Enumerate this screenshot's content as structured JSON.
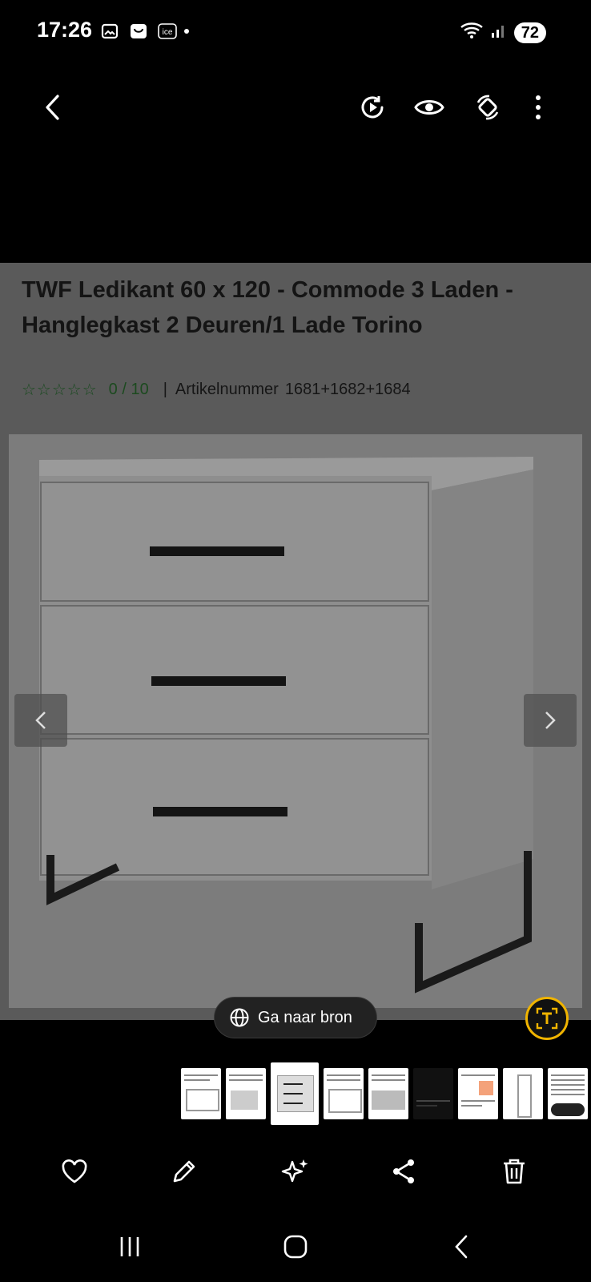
{
  "status_bar": {
    "time": "17:26",
    "left_icons": [
      "photo-frame-icon",
      "shopping-bag-icon",
      "ice-app-icon"
    ],
    "ice_label": "ice",
    "battery": "72",
    "right_icons": [
      "wifi-icon",
      "signal-icon"
    ]
  },
  "top_bar": {
    "back_icon": "chevron-left-icon",
    "actions": [
      "remaster-icon",
      "eye-icon",
      "rotate-icon",
      "more-vert-icon"
    ]
  },
  "document": {
    "title": "TWF Ledikant 60 x 120 - Commode 3 Laden - Hanglegkast 2 Deuren/1 Lade Torino",
    "stars": "☆☆☆☆☆",
    "rating": "0 / 10",
    "separator": "|",
    "article_label": "Artikelnummer",
    "article_number": "1681+1682+1684"
  },
  "gallery": {
    "prev_icon": "chevron-left-icon",
    "next_icon": "chevron-right-icon"
  },
  "source_button": {
    "label": "Ga naar bron",
    "icon": "globe-icon"
  },
  "ocr_button": {
    "icon": "text-extract-icon"
  },
  "bottom_actions": [
    "heart-icon",
    "pencil-icon",
    "sparkle-icon",
    "share-icon",
    "trash-icon"
  ],
  "system_nav": [
    "recents-icon",
    "home-icon",
    "back-icon"
  ],
  "colors": {
    "accent": "#f0b400",
    "star_green": "#184a1e"
  }
}
